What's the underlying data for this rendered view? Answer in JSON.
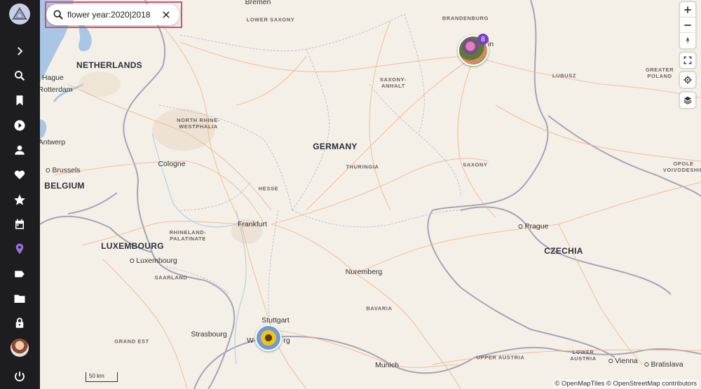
{
  "search": {
    "value": "flower year:2020|2018"
  },
  "sidebar": {
    "items": [
      "expand",
      "search",
      "bookmark",
      "video",
      "people",
      "favorites",
      "moments",
      "calendar",
      "places",
      "labels",
      "folders",
      "private",
      "account",
      "logout"
    ]
  },
  "map": {
    "countries": [
      {
        "name": "NETHERLANDS"
      },
      {
        "name": "GERMANY"
      },
      {
        "name": "BELGIUM"
      },
      {
        "name": "LUXEMBOURG"
      },
      {
        "name": "CZECHIA"
      }
    ],
    "regions": [
      {
        "name": "LOWER SAXONY"
      },
      {
        "name": "BRANDENBURG"
      },
      {
        "name": "SAXONY-\nANHALT"
      },
      {
        "name": "NORTH RHINE-\nWESTPHALIA"
      },
      {
        "name": "THURINGIA"
      },
      {
        "name": "SAXONY"
      },
      {
        "name": "HESSE"
      },
      {
        "name": "RHINELAND-\nPALATINATE"
      },
      {
        "name": "SAARLAND"
      },
      {
        "name": "BAVARIA"
      },
      {
        "name": "GRAND EST"
      },
      {
        "name": "UPPER AUSTRIA"
      },
      {
        "name": "LOWER\nAUSTRIA"
      },
      {
        "name": "LUBUSZ"
      },
      {
        "name": "GREATER\nPOLAND"
      },
      {
        "name": "OPOLE\nVOIVODESHIP"
      }
    ],
    "cities": [
      {
        "name": "Bremen"
      },
      {
        "name": "e Hague"
      },
      {
        "name": "Rotterdam"
      },
      {
        "name": "Antwerp"
      },
      {
        "name": "Brussels"
      },
      {
        "name": "Cologne"
      },
      {
        "name": "Frankfurt"
      },
      {
        "name": "Luxembourg"
      },
      {
        "name": "Prague"
      },
      {
        "name": "Nuremberg"
      },
      {
        "name": "Stuttgart"
      },
      {
        "name": "Strasbourg"
      },
      {
        "name": "Munich"
      },
      {
        "name": "Vienna"
      },
      {
        "name": "Bratislava"
      },
      {
        "name": "in"
      },
      {
        "name": "W"
      },
      {
        "name": "rg"
      }
    ],
    "cluster_count": "8",
    "scale_label": "50 km",
    "attribution": "© OpenMapTiles © OpenStreetMap contributors"
  },
  "colors": {
    "accent": "#7b3fbf",
    "highlight": "#d0527c",
    "sidebar": "#1d1d1f"
  }
}
